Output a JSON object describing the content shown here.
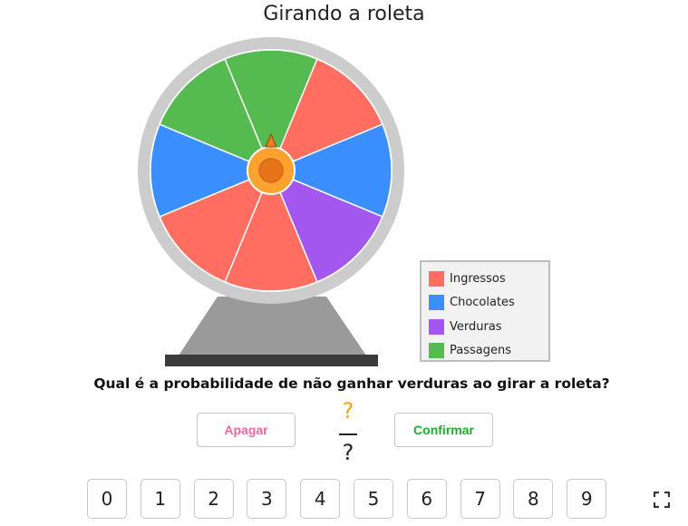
{
  "title": "Girando a roleta",
  "legend": [
    {
      "label": "Ingressos",
      "color": "#ff6e61"
    },
    {
      "label": "Chocolates",
      "color": "#3a8efe"
    },
    {
      "label": "Verduras",
      "color": "#a357ef"
    },
    {
      "label": "Passagens",
      "color": "#55ba4f"
    }
  ],
  "wheel_sectors": [
    "Passagens",
    "Ingressos",
    "Chocolates",
    "Verduras",
    "Ingressos",
    "Ingressos",
    "Chocolates",
    "Passagens"
  ],
  "question": "Qual é a probabilidade de não ganhar verduras ao girar a roleta?",
  "fraction": {
    "numerator": "?",
    "denominator": "?"
  },
  "buttons": {
    "apagar": "Apagar",
    "confirmar": "Confirmar"
  },
  "keypad": [
    "0",
    "1",
    "2",
    "3",
    "4",
    "5",
    "6",
    "7",
    "8",
    "9"
  ],
  "icons": {
    "fullscreen": "fullscreen-icon",
    "pointer": "pointer-triangle-icon"
  }
}
